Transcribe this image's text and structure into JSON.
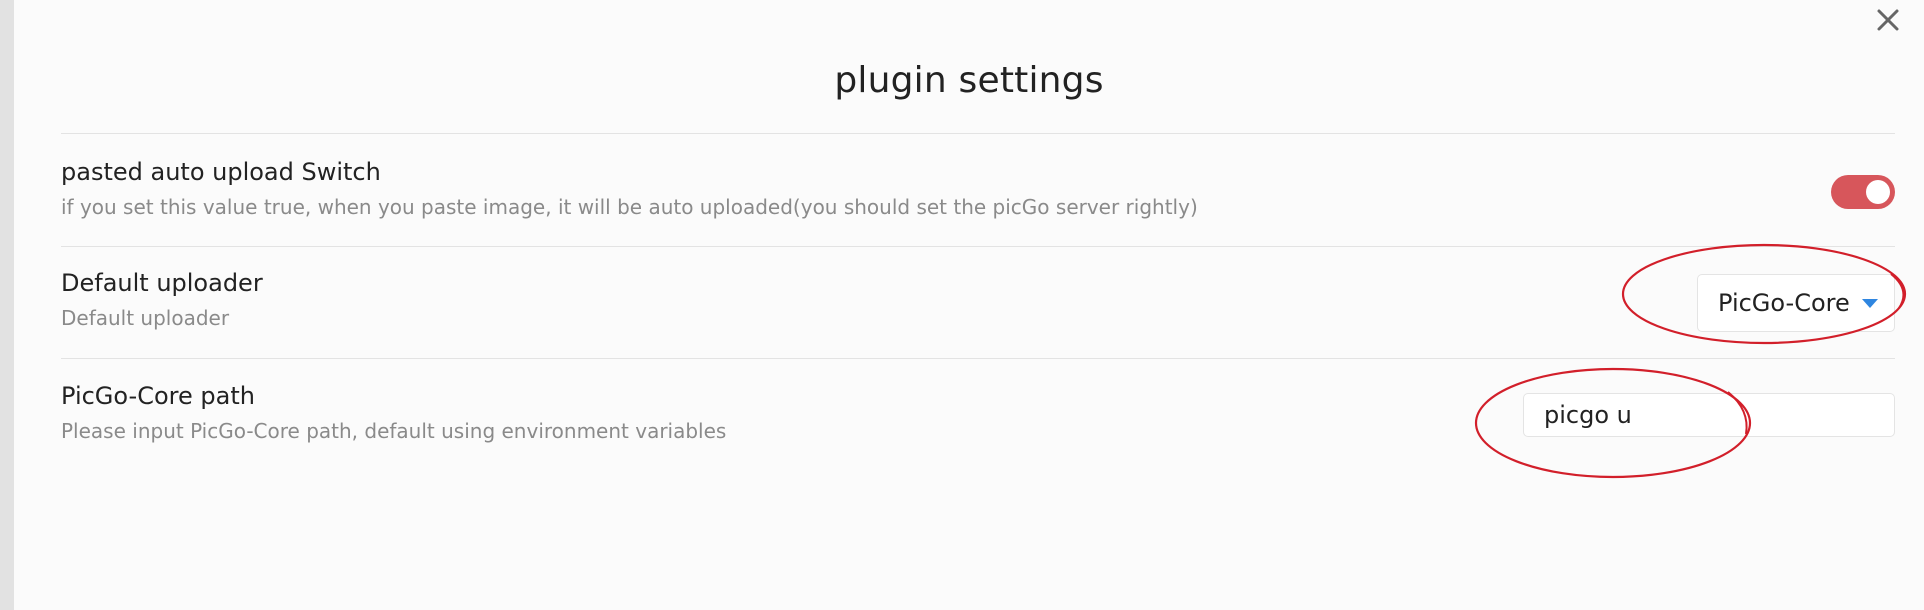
{
  "modal": {
    "title": "plugin settings",
    "close_icon": "close-icon"
  },
  "settings": [
    {
      "name": "pasted auto upload Switch",
      "description": "if you set this value true, when you paste image, it will be auto uploaded(you should set the picGo server rightly)",
      "control": "toggle",
      "value": true
    },
    {
      "name": "Default uploader",
      "description": "Default uploader",
      "control": "select",
      "value": "PicGo-Core"
    },
    {
      "name": "PicGo-Core path",
      "description": "Please input PicGo-Core path, default using environment variables",
      "control": "text-input",
      "value": "picgo u"
    }
  ],
  "colors": {
    "toggle_on": "#d7565b",
    "select_caret": "#2f86e0",
    "annotation_red": "#d21f2a",
    "background": "#fbfbfb"
  }
}
